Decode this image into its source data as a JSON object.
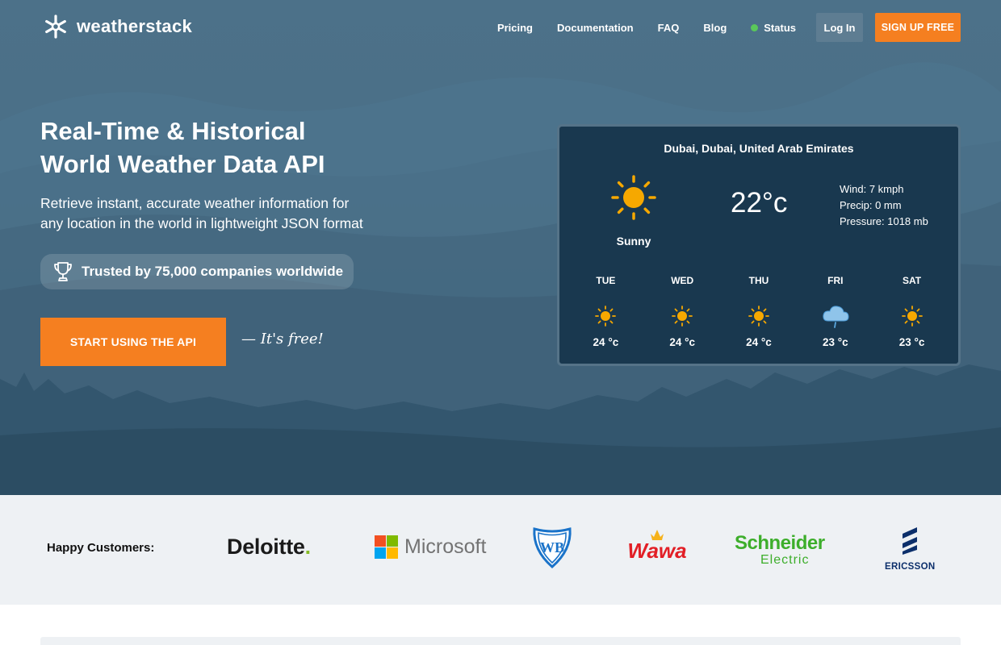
{
  "brand": {
    "name": "weatherstack",
    "logo_icon": "snowflake-icon"
  },
  "nav": {
    "items": [
      "Pricing",
      "Documentation",
      "FAQ",
      "Blog"
    ],
    "status_label": "Status",
    "status_color": "#5ac85a",
    "login_label": "Log In",
    "signup_label": "SIGN UP FREE"
  },
  "hero": {
    "headline_line1": "Real-Time & Historical",
    "headline_line2": "World Weather Data API",
    "sub_line1": "Retrieve instant, accurate weather information for",
    "sub_line2": "any location in the world in lightweight JSON format",
    "trusted_text": "Trusted by 75,000 companies worldwide",
    "trusted_icon": "trophy-icon",
    "cta_label": "START USING THE API",
    "free_text": "— It's free!"
  },
  "weather": {
    "location": "Dubai, Dubai, United Arab Emirates",
    "condition": "Sunny",
    "temperature": "22°c",
    "wind": "Wind: 7 kmph",
    "precip": "Precip: 0 mm",
    "pressure": "Pressure: 1018 mb",
    "forecast": [
      {
        "day": "TUE",
        "temp": "24 °c",
        "icon": "sun-icon"
      },
      {
        "day": "WED",
        "temp": "24 °c",
        "icon": "sun-icon"
      },
      {
        "day": "THU",
        "temp": "24 °c",
        "icon": "sun-icon"
      },
      {
        "day": "FRI",
        "temp": "23 °c",
        "icon": "rain-cloud-icon"
      },
      {
        "day": "SAT",
        "temp": "23 °c",
        "icon": "sun-icon"
      }
    ]
  },
  "customers": {
    "label": "Happy Customers:",
    "logos": [
      "Deloitte",
      "Microsoft",
      "WB",
      "Wawa",
      "Schneider",
      "Electric",
      "ERICSSON"
    ]
  },
  "colors": {
    "accent": "#f57f20",
    "widget_bg": "#19384f",
    "sun": "#f6a800"
  }
}
